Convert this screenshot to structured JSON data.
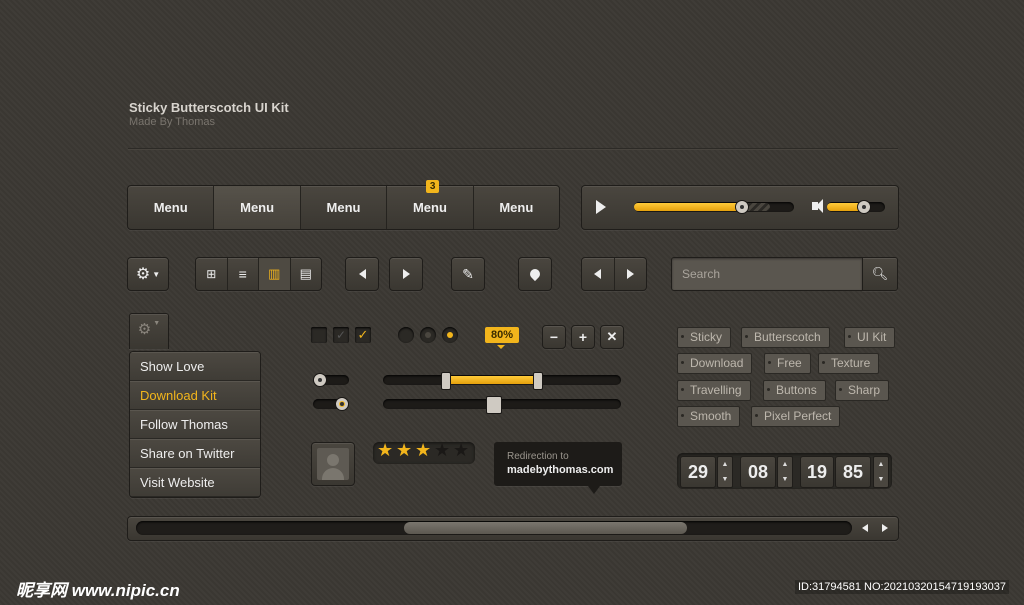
{
  "header": {
    "title": "Sticky Butterscotch UI Kit",
    "subtitle": "Made By Thomas"
  },
  "menubar": {
    "items": [
      "Menu",
      "Menu",
      "Menu",
      "Menu",
      "Menu"
    ],
    "active_index": 1,
    "badge": "3",
    "badge_item_index": 3
  },
  "player": {
    "progress": 0.7,
    "buffered": 0.85,
    "volume": 0.7,
    "play_icon": "play-icon",
    "volume_icon": "speaker-icon"
  },
  "toolbar": {
    "settings_icon": "gear-icon",
    "view_icons": [
      "grid-icon",
      "list-icon",
      "columns-icon",
      "cover-flow-icon"
    ],
    "active_view": 2
  },
  "search": {
    "placeholder": "Search",
    "icon": "search-icon"
  },
  "dropdown": {
    "options": [
      "Show Love",
      "Download Kit",
      "Follow Thomas",
      "Share on Twitter",
      "Visit Website"
    ],
    "selected_index": 1
  },
  "controls": {
    "tooltip_value": "80%",
    "range_low": 0.2,
    "range_high": 0.6,
    "slider_value": 0.45
  },
  "rating": {
    "value": 3,
    "max": 5
  },
  "tooltip": {
    "line1": "Redirection to",
    "line2": "madebythomas.com"
  },
  "tags": [
    "Sticky",
    "Butterscotch",
    "UI Kit",
    "Download",
    "Free",
    "Texture",
    "Travelling",
    "Buttons",
    "Sharp",
    "Smooth",
    "Pixel Perfect"
  ],
  "countdown": [
    "29",
    "08",
    "19",
    "85"
  ],
  "accent_color": "#f2b51c",
  "watermark": {
    "logo": "昵享网 www.nipic.cn",
    "id": "ID:31794581 NO:20210320154719193037"
  }
}
